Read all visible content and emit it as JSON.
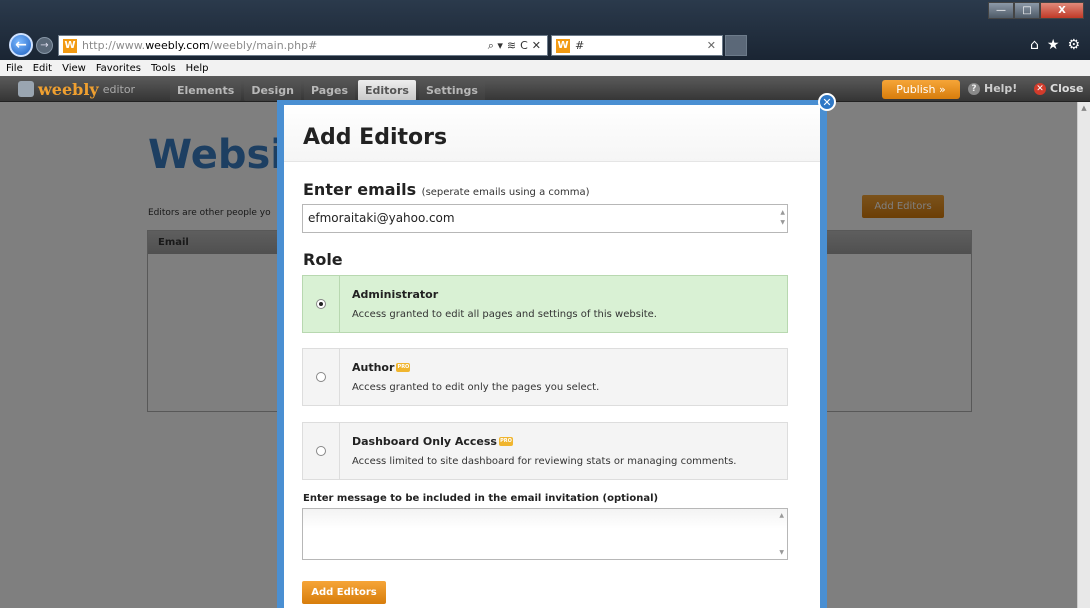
{
  "browser": {
    "url_prefix": "http://www.",
    "url_domain": "weebly.com",
    "url_path": "/weebly/main.php#",
    "tab_title": "#",
    "favicon_letter": "W",
    "address_tools": [
      "⌕ ▾",
      "≋",
      "C",
      "✕"
    ],
    "menu": [
      "File",
      "Edit",
      "View",
      "Favorites",
      "Tools",
      "Help"
    ],
    "window_controls": [
      "—",
      "□",
      "X"
    ],
    "right_icons": [
      "⌂",
      "★",
      "⚙"
    ]
  },
  "toolbar": {
    "logo": "weebly",
    "logo_sub": "editor",
    "tabs": [
      "Elements",
      "Design",
      "Pages",
      "Editors",
      "Settings"
    ],
    "active_tab": "Editors",
    "publish": "Publish »",
    "help": "Help!",
    "close": "Close"
  },
  "page": {
    "title": "Website",
    "description": "Editors are other people yo",
    "add_button": "Add Editors",
    "table_header": "Email"
  },
  "modal": {
    "title": "Add Editors",
    "emails_label": "Enter emails",
    "emails_hint": "(seperate emails using a comma)",
    "emails_value": "efmoraitaki@yahoo.com",
    "role_label": "Role",
    "roles": [
      {
        "name": "Administrator",
        "desc": "Access granted to edit all pages and settings of this website.",
        "pro": false,
        "selected": true
      },
      {
        "name": "Author",
        "desc": "Access granted to edit only the pages you select.",
        "pro": true,
        "selected": false
      },
      {
        "name": "Dashboard Only Access",
        "desc": "Access limited to site dashboard for reviewing stats or managing comments.",
        "pro": true,
        "selected": false
      }
    ],
    "message_label": "Enter message to be included in the email invitation (optional)",
    "message_value": "",
    "submit": "Add Editors",
    "pro_badge": "PRO"
  },
  "colors": {
    "accent_orange": "#e88f1a",
    "modal_border_blue": "#4a8fd2",
    "title_blue": "#3a7fc4",
    "selected_green": "#d9f1d4"
  }
}
